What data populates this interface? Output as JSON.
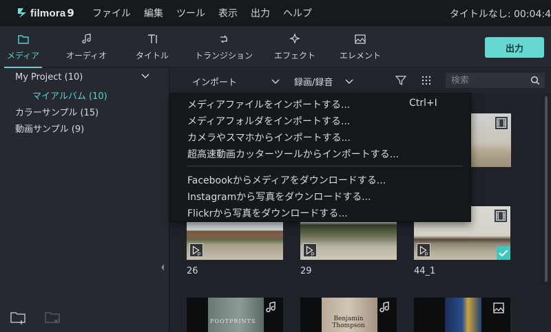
{
  "app": {
    "name": "filmora",
    "version": "9",
    "project_title": "タイトルなし: 00:04:4"
  },
  "menubar": [
    "ファイル",
    "編集",
    "ツール",
    "表示",
    "出力",
    "ヘルプ"
  ],
  "toolbar": {
    "tabs": [
      {
        "label": "メディア",
        "icon": "folder-icon",
        "active": true
      },
      {
        "label": "オーディオ",
        "icon": "music-note-icon",
        "active": false
      },
      {
        "label": "タイトル",
        "icon": "text-icon",
        "active": false
      },
      {
        "label": "トランジション",
        "icon": "transition-icon",
        "active": false
      },
      {
        "label": "エフェクト",
        "icon": "effects-icon",
        "active": false
      },
      {
        "label": "エレメント",
        "icon": "image-icon",
        "active": false
      }
    ],
    "export_label": "出力"
  },
  "sidebar": {
    "items": [
      {
        "label": "My Project (10)"
      },
      {
        "label": "マイアルバム (10)"
      },
      {
        "label": "カラーサンプル (15)"
      },
      {
        "label": "動画サンプル (9)"
      }
    ]
  },
  "media_header": {
    "import_label": "インポート",
    "record_label": "録画/録音",
    "search_placeholder": "検索"
  },
  "import_menu": {
    "items": [
      {
        "label": "メディアファイルをインポートする...",
        "shortcut": "Ctrl+I"
      },
      {
        "label": "メディアフォルダをインポートする..."
      },
      {
        "label": "カメラやスマホからインポートする..."
      },
      {
        "label": "超高速動画カッターツールからインポートする..."
      },
      {
        "label": "Facebookからメディアをダウンロードする..."
      },
      {
        "label": "Instagramから写真をダウンロードする..."
      },
      {
        "label": "Flickrから写真をダウンロードする..."
      }
    ]
  },
  "media": {
    "items": [
      {
        "label": "26"
      },
      {
        "label": "29"
      },
      {
        "label": "44_1"
      }
    ],
    "bottom_row": [
      {
        "caption": "FOOTPRINTS"
      },
      {
        "caption": "Benjamin Thompson"
      },
      {
        "caption": ""
      }
    ]
  },
  "colors": {
    "accent": "#55d4d3",
    "export_button": "#65d8d1",
    "background": "#1f2329",
    "panel": "#262a30"
  }
}
